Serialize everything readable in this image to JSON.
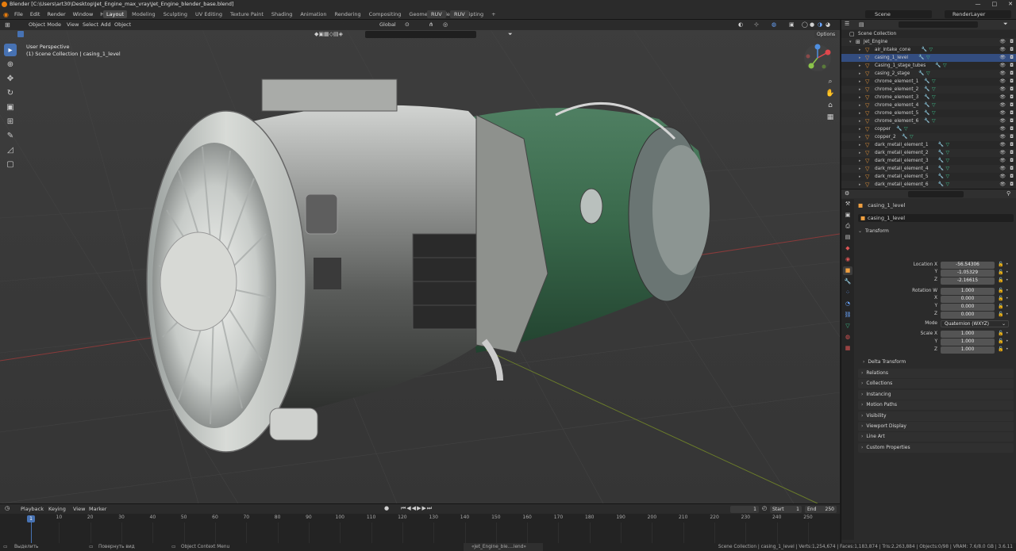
{
  "title_bar": {
    "title": "Blender [C:\\Users\\art30\\Desktop\\Jet_Engine_max_vray\\Jet_Engine_blender_base.blend]",
    "minimize": "—",
    "maximize": "□",
    "close": "✕"
  },
  "menu": [
    "File",
    "Edit",
    "Render",
    "Window",
    "Help"
  ],
  "workspaces": [
    {
      "label": "Layout",
      "active": true
    },
    {
      "label": "Modeling"
    },
    {
      "label": "Sculpting"
    },
    {
      "label": "UV Editing"
    },
    {
      "label": "Texture Paint"
    },
    {
      "label": "Shading"
    },
    {
      "label": "Animation"
    },
    {
      "label": "Rendering"
    },
    {
      "label": "Compositing"
    },
    {
      "label": "Geometry Nodes"
    },
    {
      "label": "Scripting"
    }
  ],
  "add_workspace": "+",
  "ruv_buttons": [
    "RUV",
    "RUV"
  ],
  "scene": {
    "label": "Scene",
    "render_layer": "RenderLayer"
  },
  "viewport": {
    "mode": "Object Mode",
    "menus": [
      "View",
      "Select",
      "Add",
      "Object"
    ],
    "orientation": "Global",
    "options": "Options",
    "perspective": "User Perspective",
    "collection_path": "(1) Scene Collection | casing_1_level"
  },
  "tools": [
    {
      "icon": "select-box-icon",
      "glyph": "▸",
      "active": true
    },
    {
      "icon": "cursor-icon",
      "glyph": "⊕"
    },
    {
      "icon": "move-icon",
      "glyph": "✥"
    },
    {
      "icon": "rotate-icon",
      "glyph": "↻"
    },
    {
      "icon": "scale-icon",
      "glyph": "▣"
    },
    {
      "icon": "transform-icon",
      "glyph": "⊞"
    },
    {
      "icon": "annotate-icon",
      "glyph": "✎"
    },
    {
      "icon": "measure-icon",
      "glyph": "◿"
    },
    {
      "icon": "add-cube-icon",
      "glyph": "▢"
    }
  ],
  "outliner": {
    "root": "Scene Collection",
    "collection": "Jet_Engine",
    "objects": [
      {
        "name": "air_intake_cone"
      },
      {
        "name": "casing_1_level",
        "selected": true
      },
      {
        "name": "Casing_1_stage_tubes"
      },
      {
        "name": "casing_2_stage"
      },
      {
        "name": "chrome_element_1"
      },
      {
        "name": "chrome_element_2"
      },
      {
        "name": "chrome_element_3"
      },
      {
        "name": "chrome_element_4"
      },
      {
        "name": "chrome_element_5"
      },
      {
        "name": "chrome_element_6"
      },
      {
        "name": "copper"
      },
      {
        "name": "copper_2"
      },
      {
        "name": "dark_metall_element_1"
      },
      {
        "name": "dark_metall_element_2"
      },
      {
        "name": "dark_metall_element_3"
      },
      {
        "name": "dark_metall_element_4"
      },
      {
        "name": "dark_metall_element_5"
      },
      {
        "name": "dark_metall_element_6"
      }
    ]
  },
  "properties": {
    "object_path": "casing_1_level",
    "object_name": "casing_1_level",
    "transform_header": "Transform",
    "location": {
      "label": "Location X",
      "x": "-56.54306",
      "y": "-1.05329",
      "z": "-2.16615"
    },
    "rotation": {
      "label": "Rotation W",
      "w": "1.000",
      "x": "0.000",
      "y": "0.000",
      "z": "0.000"
    },
    "mode": {
      "label": "Mode",
      "value": "Quaternion (WXYZ)"
    },
    "scale": {
      "label": "Scale X",
      "x": "1.000",
      "y": "1.000",
      "z": "1.000"
    },
    "axis_y": "Y",
    "axis_z": "Z",
    "axis_x": "X",
    "delta_transform": "Delta Transform",
    "panels": [
      "Relations",
      "Collections",
      "Instancing",
      "Motion Paths",
      "Visibility",
      "Viewport Display",
      "Line Art",
      "Custom Properties"
    ]
  },
  "timeline": {
    "menus": [
      "Playback",
      "Keying",
      "View",
      "Marker"
    ],
    "current_frame": "1",
    "start_label": "Start",
    "start": "1",
    "end_label": "End",
    "end": "250",
    "ticks": [
      "10",
      "20",
      "30",
      "40",
      "50",
      "60",
      "70",
      "80",
      "90",
      "100",
      "110",
      "120",
      "130",
      "140",
      "150",
      "160",
      "170",
      "180",
      "190",
      "200",
      "210",
      "220",
      "230",
      "240",
      "250"
    ],
    "playhead": "1"
  },
  "status": {
    "select": "Выделить",
    "rotate": "Повернуть вид",
    "context": "Object Context Menu",
    "saved": "«Jet_Engine_ble....lend» сохранено",
    "stats": "Scene Collection | casing_1_level | Verts:1,254,674 | Faces:1,183,874 | Tris:2,263,884 | Objects:0/98 | VRAM: 7.6/8.0 GB | 3.6.11"
  },
  "colors": {
    "accent": "#4772b3",
    "engine_body": "#b8bdbf",
    "engine_rear": "#3e6b4f"
  }
}
